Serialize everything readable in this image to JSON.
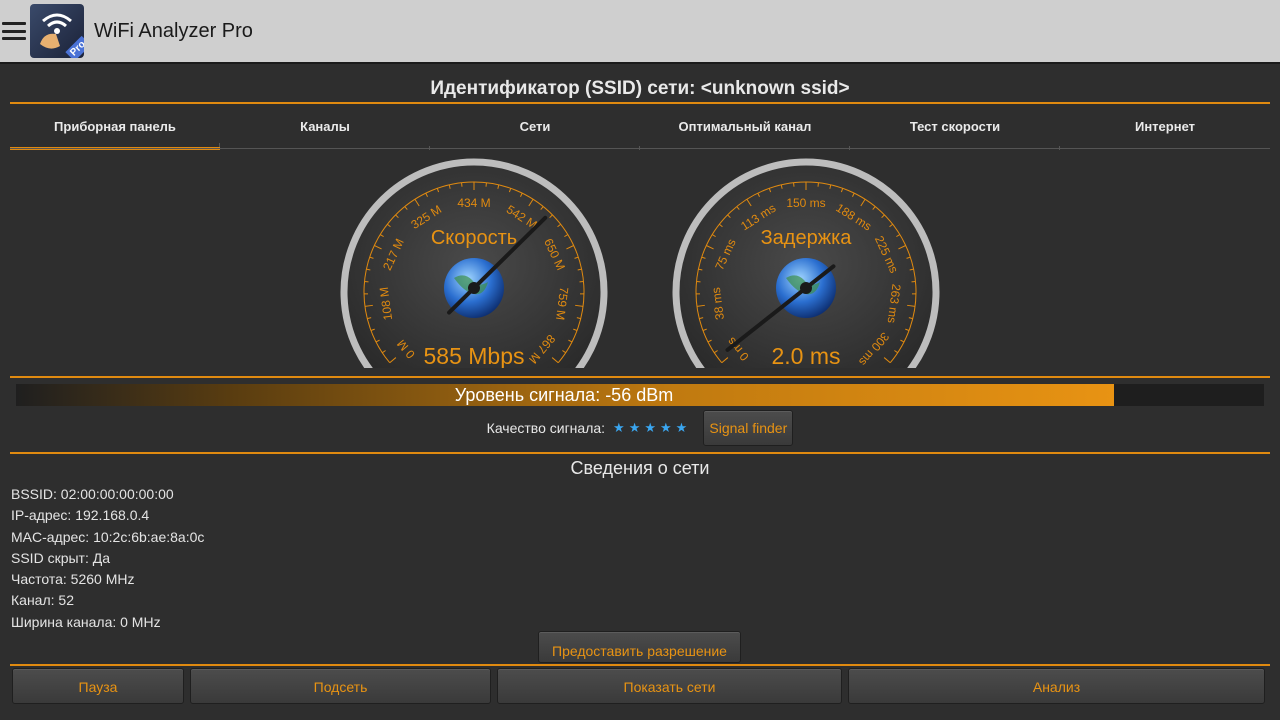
{
  "app": {
    "title": "WiFi Analyzer Pro",
    "logo_badge": "Pro",
    "menu_icon": "hamburger-menu-icon",
    "accent": "#e08a10"
  },
  "network": {
    "ssid_title": "Идентификатор (SSID) сети: <unknown ssid>"
  },
  "tabs": [
    {
      "label": "Приборная панель",
      "active": true
    },
    {
      "label": "Каналы",
      "active": false
    },
    {
      "label": "Сети",
      "active": false
    },
    {
      "label": "Оптимальный канал",
      "active": false
    },
    {
      "label": "Тест скорости",
      "active": false
    },
    {
      "label": "Интернет",
      "active": false
    }
  ],
  "gauges": {
    "speed": {
      "label": "Скорость",
      "value_text": "585 Mbps",
      "value": 585,
      "max": 867,
      "ticks": [
        "0 M",
        "108 M",
        "217 M",
        "325 M",
        "434 M",
        "542 M",
        "650 M",
        "759 M",
        "867 M"
      ]
    },
    "latency": {
      "label": "Задержка",
      "value_text": "2.0 ms",
      "value": 2.0,
      "max": 300,
      "ticks": [
        "0 ms",
        "38 ms",
        "75 ms",
        "113 ms",
        "150 ms",
        "188 ms",
        "225 ms",
        "263 ms",
        "300 ms"
      ]
    }
  },
  "signal": {
    "label": "Уровень сигнала: -56 dBm",
    "level_fraction": 0.88
  },
  "quality": {
    "label": "Качество сигнала:",
    "stars": 5,
    "finder_button": "Signal finder"
  },
  "info": {
    "title": "Сведения о сети",
    "rows": [
      "BSSID: 02:00:00:00:00:00",
      "IP-адрес: 192.168.0.4",
      "MAC-адрес: 10:2c:6b:ae:8a:0c",
      "SSID скрыт: Да",
      "Частота: 5260 MHz",
      "Канал: 52",
      "Ширина канала: 0 MHz"
    ]
  },
  "grant_button": "Предоставить разрешение",
  "bottom": {
    "pause": "Пауза",
    "subnet": "Подсеть",
    "show_networks": "Показать сети",
    "analysis": "Анализ"
  }
}
